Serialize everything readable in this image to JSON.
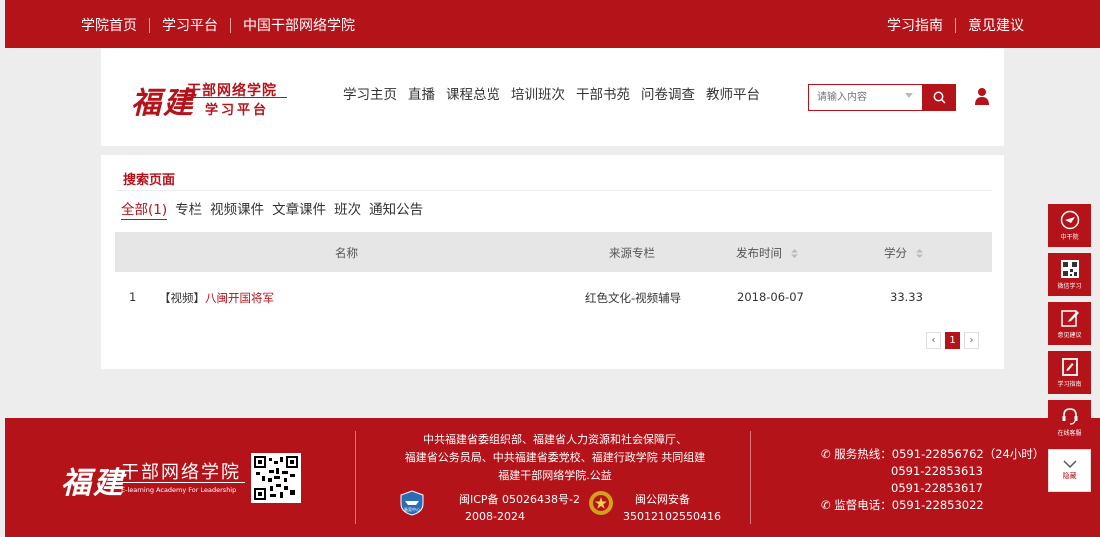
{
  "topbar": {
    "left_links": [
      "学院首页",
      "学习平台",
      "中国干部网络学院"
    ],
    "right_links": [
      "学习指南",
      "意见建议"
    ]
  },
  "header": {
    "logo_script": "福建",
    "logo_title": "干部网络学院",
    "logo_subtitle": "学习平台",
    "nav": [
      "学习主页",
      "直播",
      "课程总览",
      "培训班次",
      "干部书苑",
      "问卷调查",
      "教师平台"
    ],
    "search_placeholder": "请输入内容"
  },
  "main": {
    "title": "搜索页面",
    "tabs": [
      "全部(1)",
      "专栏",
      "视频课件",
      "文章课件",
      "班次",
      "通知公告"
    ],
    "columns": {
      "name": "名称",
      "source": "来源专栏",
      "date": "发布时间",
      "credit": "学分"
    },
    "rows": [
      {
        "index": "1",
        "type": "【视频】",
        "title": "八闽开国将军",
        "source": "红色文化-视频辅导",
        "date": "2018-06-07",
        "credit": "33.33"
      }
    ],
    "pager": {
      "prev": "‹",
      "current": "1",
      "next": "›"
    }
  },
  "footer": {
    "logo_script": "福建",
    "logo_title": "干部网络学院",
    "logo_en": "E-learning Academy For Leadership",
    "org_line1": "中共福建省委组织部、福建省人力资源和社会保障厅、",
    "org_line2": "福建省公务员局、中共福建省委党校、福建行政学院 共同组建",
    "org_line3": "福建干部网络学院.公益",
    "icp_line1": "闽ICP备 05026438号-2",
    "icp_line2": "2008-2024",
    "police_line1": "闽公网安备",
    "police_line2": "35012102550416",
    "hotline": "服务热线：0591-22856762（24小时）",
    "hotline2": "0591-22853613",
    "hotline3": "0591-22853617",
    "supervise": "监督电话：0591-22853022",
    "badge_label": "备案中心"
  },
  "sidebar": {
    "items": [
      "中干院",
      "微信学习",
      "意见建议",
      "学习指南",
      "在线客服",
      "隐藏"
    ]
  },
  "colors": {
    "brand": "#b5131a"
  }
}
